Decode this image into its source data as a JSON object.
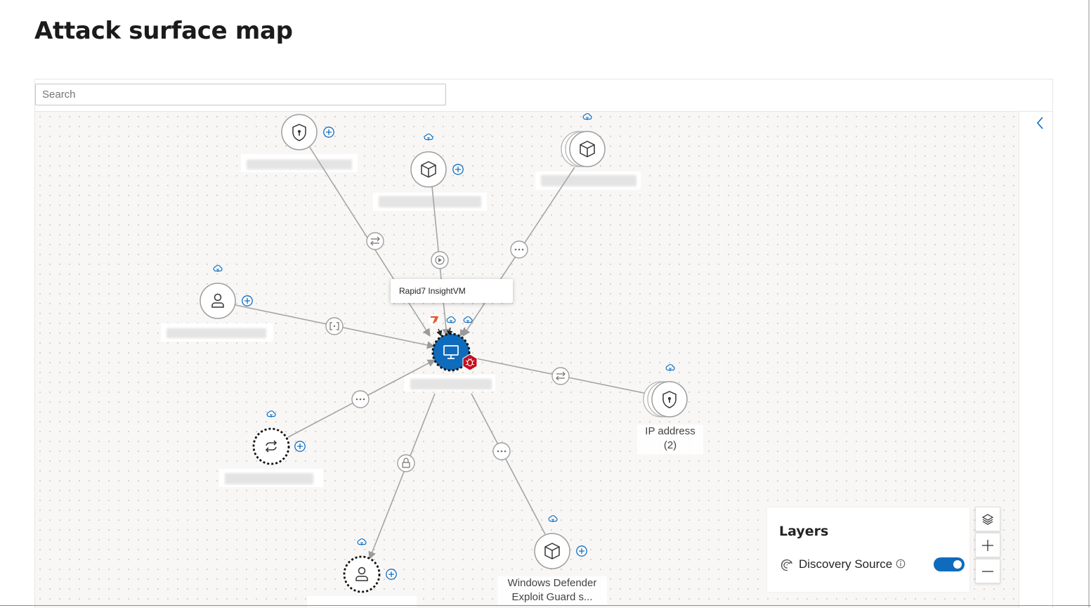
{
  "page": {
    "title": "Attack surface map"
  },
  "search": {
    "placeholder": "Search"
  },
  "tooltip": {
    "text": "Rapid7 InsightVM"
  },
  "nodes": {
    "ip_address": {
      "label_line1": "IP address",
      "label_line2": "(2)"
    },
    "windows_defender": {
      "label_line1": "Windows Defender",
      "label_line2": "Exploit Guard s..."
    }
  },
  "layers": {
    "title": "Layers",
    "items": [
      {
        "label": "Discovery Source",
        "enabled": true
      }
    ]
  },
  "colors": {
    "accent": "#0f6cbd",
    "center_node": "#0f6cbd",
    "alert": "#c50f1f",
    "source_badge": "#e8542b"
  },
  "icons": [
    "shield-icon",
    "cube-icon",
    "user-icon",
    "sync-icon",
    "cloud-icon",
    "monitor-icon",
    "bug-icon",
    "add-icon",
    "layers-icon",
    "zoom-in-icon",
    "zoom-out-icon",
    "chevron-left-icon",
    "info-icon",
    "discovery-icon",
    "lock-icon",
    "more-icon",
    "transfer-icon",
    "play-icon",
    "code-icon"
  ]
}
